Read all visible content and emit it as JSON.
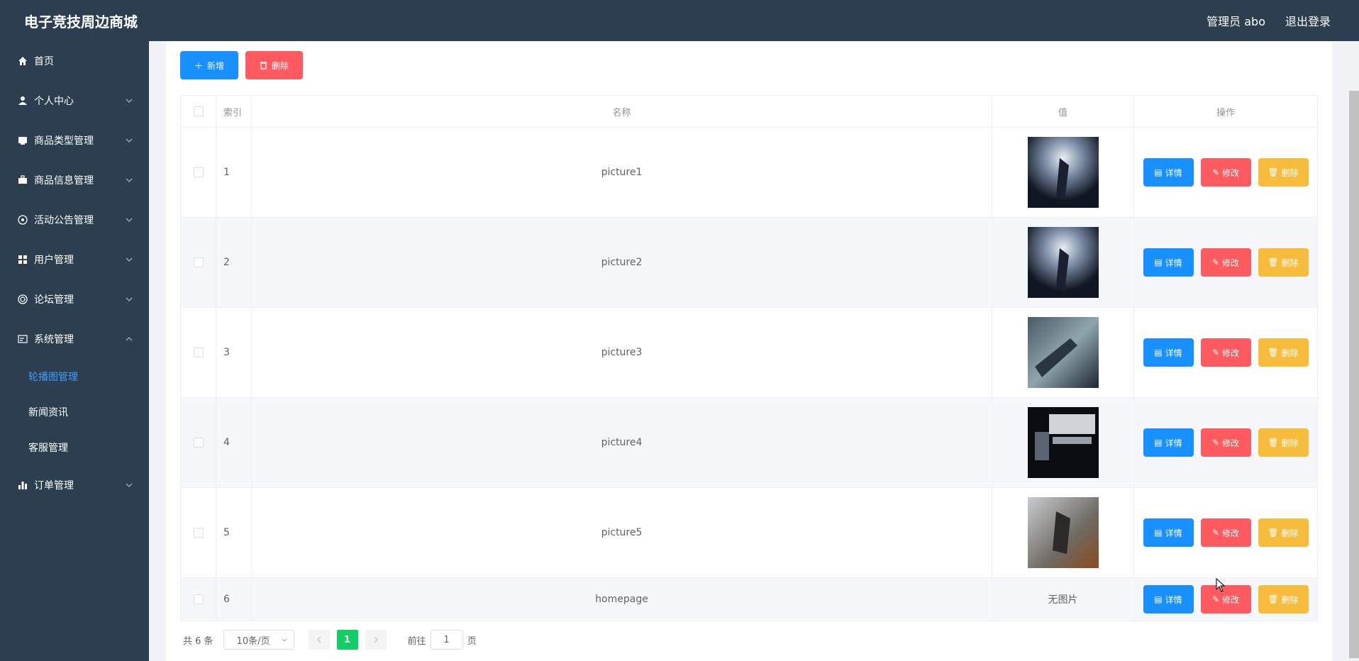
{
  "header": {
    "title": "电子竞技周边商城",
    "admin_label": "管理员 abo",
    "logout_label": "退出登录"
  },
  "sidebar": {
    "items": [
      {
        "label": "首页",
        "icon": "home-icon"
      },
      {
        "label": "个人中心",
        "icon": "user-icon"
      },
      {
        "label": "商品类型管理",
        "icon": "box-icon"
      },
      {
        "label": "商品信息管理",
        "icon": "briefcase-icon"
      },
      {
        "label": "活动公告管理",
        "icon": "target-icon"
      },
      {
        "label": "用户管理",
        "icon": "grid-icon"
      },
      {
        "label": "论坛管理",
        "icon": "chat-icon"
      },
      {
        "label": "系统管理",
        "icon": "settings-icon"
      },
      {
        "label": "订单管理",
        "icon": "chart-icon"
      }
    ],
    "system_subitems": [
      "轮播图管理",
      "新闻资讯",
      "客服管理"
    ]
  },
  "toolbar": {
    "add_label": "新增",
    "delete_label": "删除"
  },
  "table": {
    "headers": {
      "index": "索引",
      "name": "名称",
      "value": "值",
      "ops": "操作"
    },
    "rows": [
      {
        "index": "1",
        "name": "picture1",
        "value": ""
      },
      {
        "index": "2",
        "name": "picture2",
        "value": ""
      },
      {
        "index": "3",
        "name": "picture3",
        "value": ""
      },
      {
        "index": "4",
        "name": "picture4",
        "value": ""
      },
      {
        "index": "5",
        "name": "picture5",
        "value": ""
      },
      {
        "index": "6",
        "name": "homepage",
        "value": "无图片"
      }
    ],
    "op_labels": {
      "detail": "详情",
      "edit": "修改",
      "delete": "删除"
    }
  },
  "pagination": {
    "total": "共 6 条",
    "page_size": "10条/页",
    "current_page": "1",
    "goto_label": "前往",
    "goto_value": "1",
    "page_suffix": "页"
  },
  "colors": {
    "sidebar_bg": "#2c3e50",
    "primary": "#1890ff",
    "danger": "#ff5a5f",
    "warning": "#f7bc3c",
    "active_page": "#13ce66",
    "active_sub": "#409eff"
  }
}
